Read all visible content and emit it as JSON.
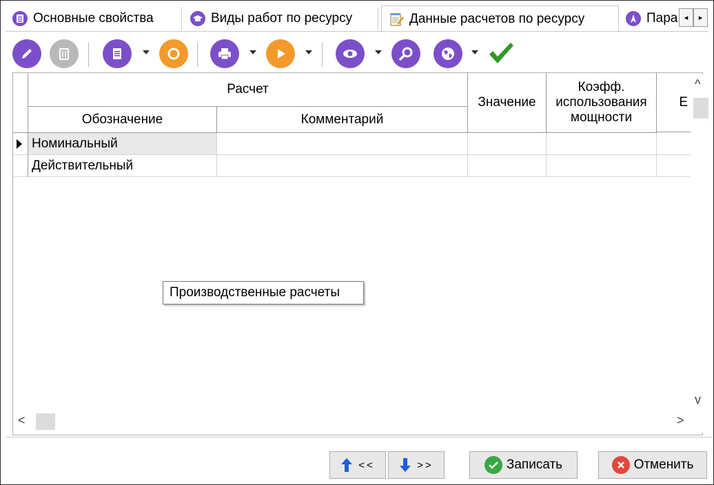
{
  "tabs": [
    {
      "label": "Основные свойства",
      "icon": "document-list-icon"
    },
    {
      "label": "Виды работ по ресурсу",
      "icon": "graduation-cap-icon"
    },
    {
      "label": "Данные расчетов по ресурсу",
      "icon": "notepad-icon"
    },
    {
      "label": "Пара",
      "icon": "compass-icon"
    }
  ],
  "tab_scroll": {
    "left": "◂",
    "right": "▸"
  },
  "toolbar": [
    "edit-icon",
    "delete-icon",
    "document-icon",
    "refresh-icon",
    "print-icon",
    "play-icon",
    "view-icon",
    "search-icon",
    "globe-icon",
    "checkmark-icon"
  ],
  "grid": {
    "group_header": "Расчет",
    "columns": {
      "designation": "Обозначение",
      "comment": "Комментарий",
      "value": "Значение",
      "capacity": "Коэфф.\nиспользования\nмощности",
      "extra": "Е"
    },
    "rows": [
      {
        "designation": "Номинальный",
        "comment": "",
        "value": "",
        "capacity": "",
        "extra": "",
        "current": true
      },
      {
        "designation": "Действительный",
        "comment": "",
        "value": "",
        "capacity": "",
        "extra": "",
        "current": false
      }
    ]
  },
  "tooltip": "Производственные расчеты",
  "scroll": {
    "up": "^",
    "down": "v",
    "left": "<",
    "right": ">"
  },
  "buttons": {
    "prev": "<<",
    "next": ">>",
    "save": "Записать",
    "cancel": "Отменить"
  },
  "colors": {
    "accent_purple": "#7b4fc9",
    "orange": "#f39a2b",
    "green": "#3aa845",
    "red": "#e0483e",
    "blue": "#1f5fd6"
  }
}
